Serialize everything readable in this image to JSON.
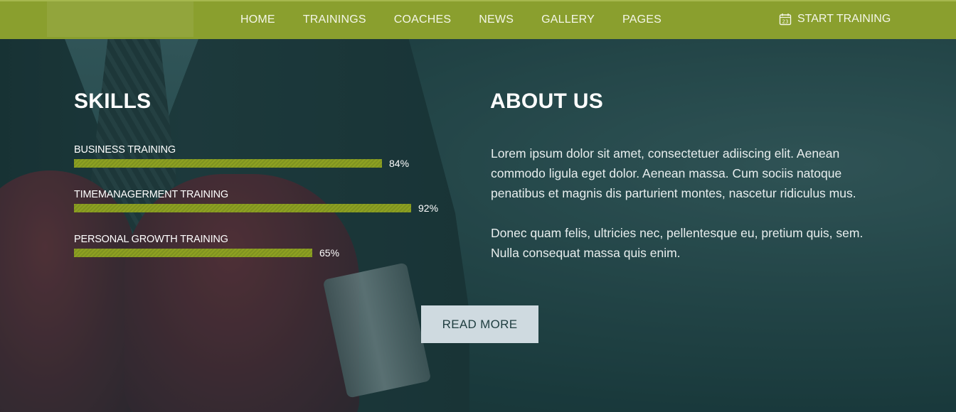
{
  "navbar": {
    "items": [
      "HOME",
      "TRAININGS",
      "COACHES",
      "NEWS",
      "GALLERY",
      "PAGES"
    ],
    "cta_label": "START TRAINING",
    "cta_icon": "calendar-icon",
    "cta_icon_day": "23",
    "background_color": "#8a9f2e"
  },
  "skills": {
    "title": "SKILLS",
    "items": [
      {
        "label": "BUSINESS TRAINING",
        "percent_text": "84%",
        "value": 84
      },
      {
        "label": "TIMEMANAGERMENT TRAINING",
        "percent_text": "92%",
        "value": 92
      },
      {
        "label": "PERSONAL GROWTH TRAINING",
        "percent_text": "65%",
        "value": 65
      }
    ],
    "bar_color": "#8ea121"
  },
  "about": {
    "title": "ABOUT US",
    "paragraph1": "Lorem ipsum dolor sit amet, consectetuer adiiscing elit. Aenean commodo ligula eget dolor. Aenean massa. Cum sociis natoque penatibus et magnis dis parturient montes, nascetur ridiculus mus.",
    "paragraph2": "Donec quam felis, ultricies nec, pellentesque eu, pretium quis, sem. Nulla consequat massa quis enim."
  },
  "cta": {
    "read_more_label": "READ MORE",
    "button_color": "#cfdae0"
  }
}
